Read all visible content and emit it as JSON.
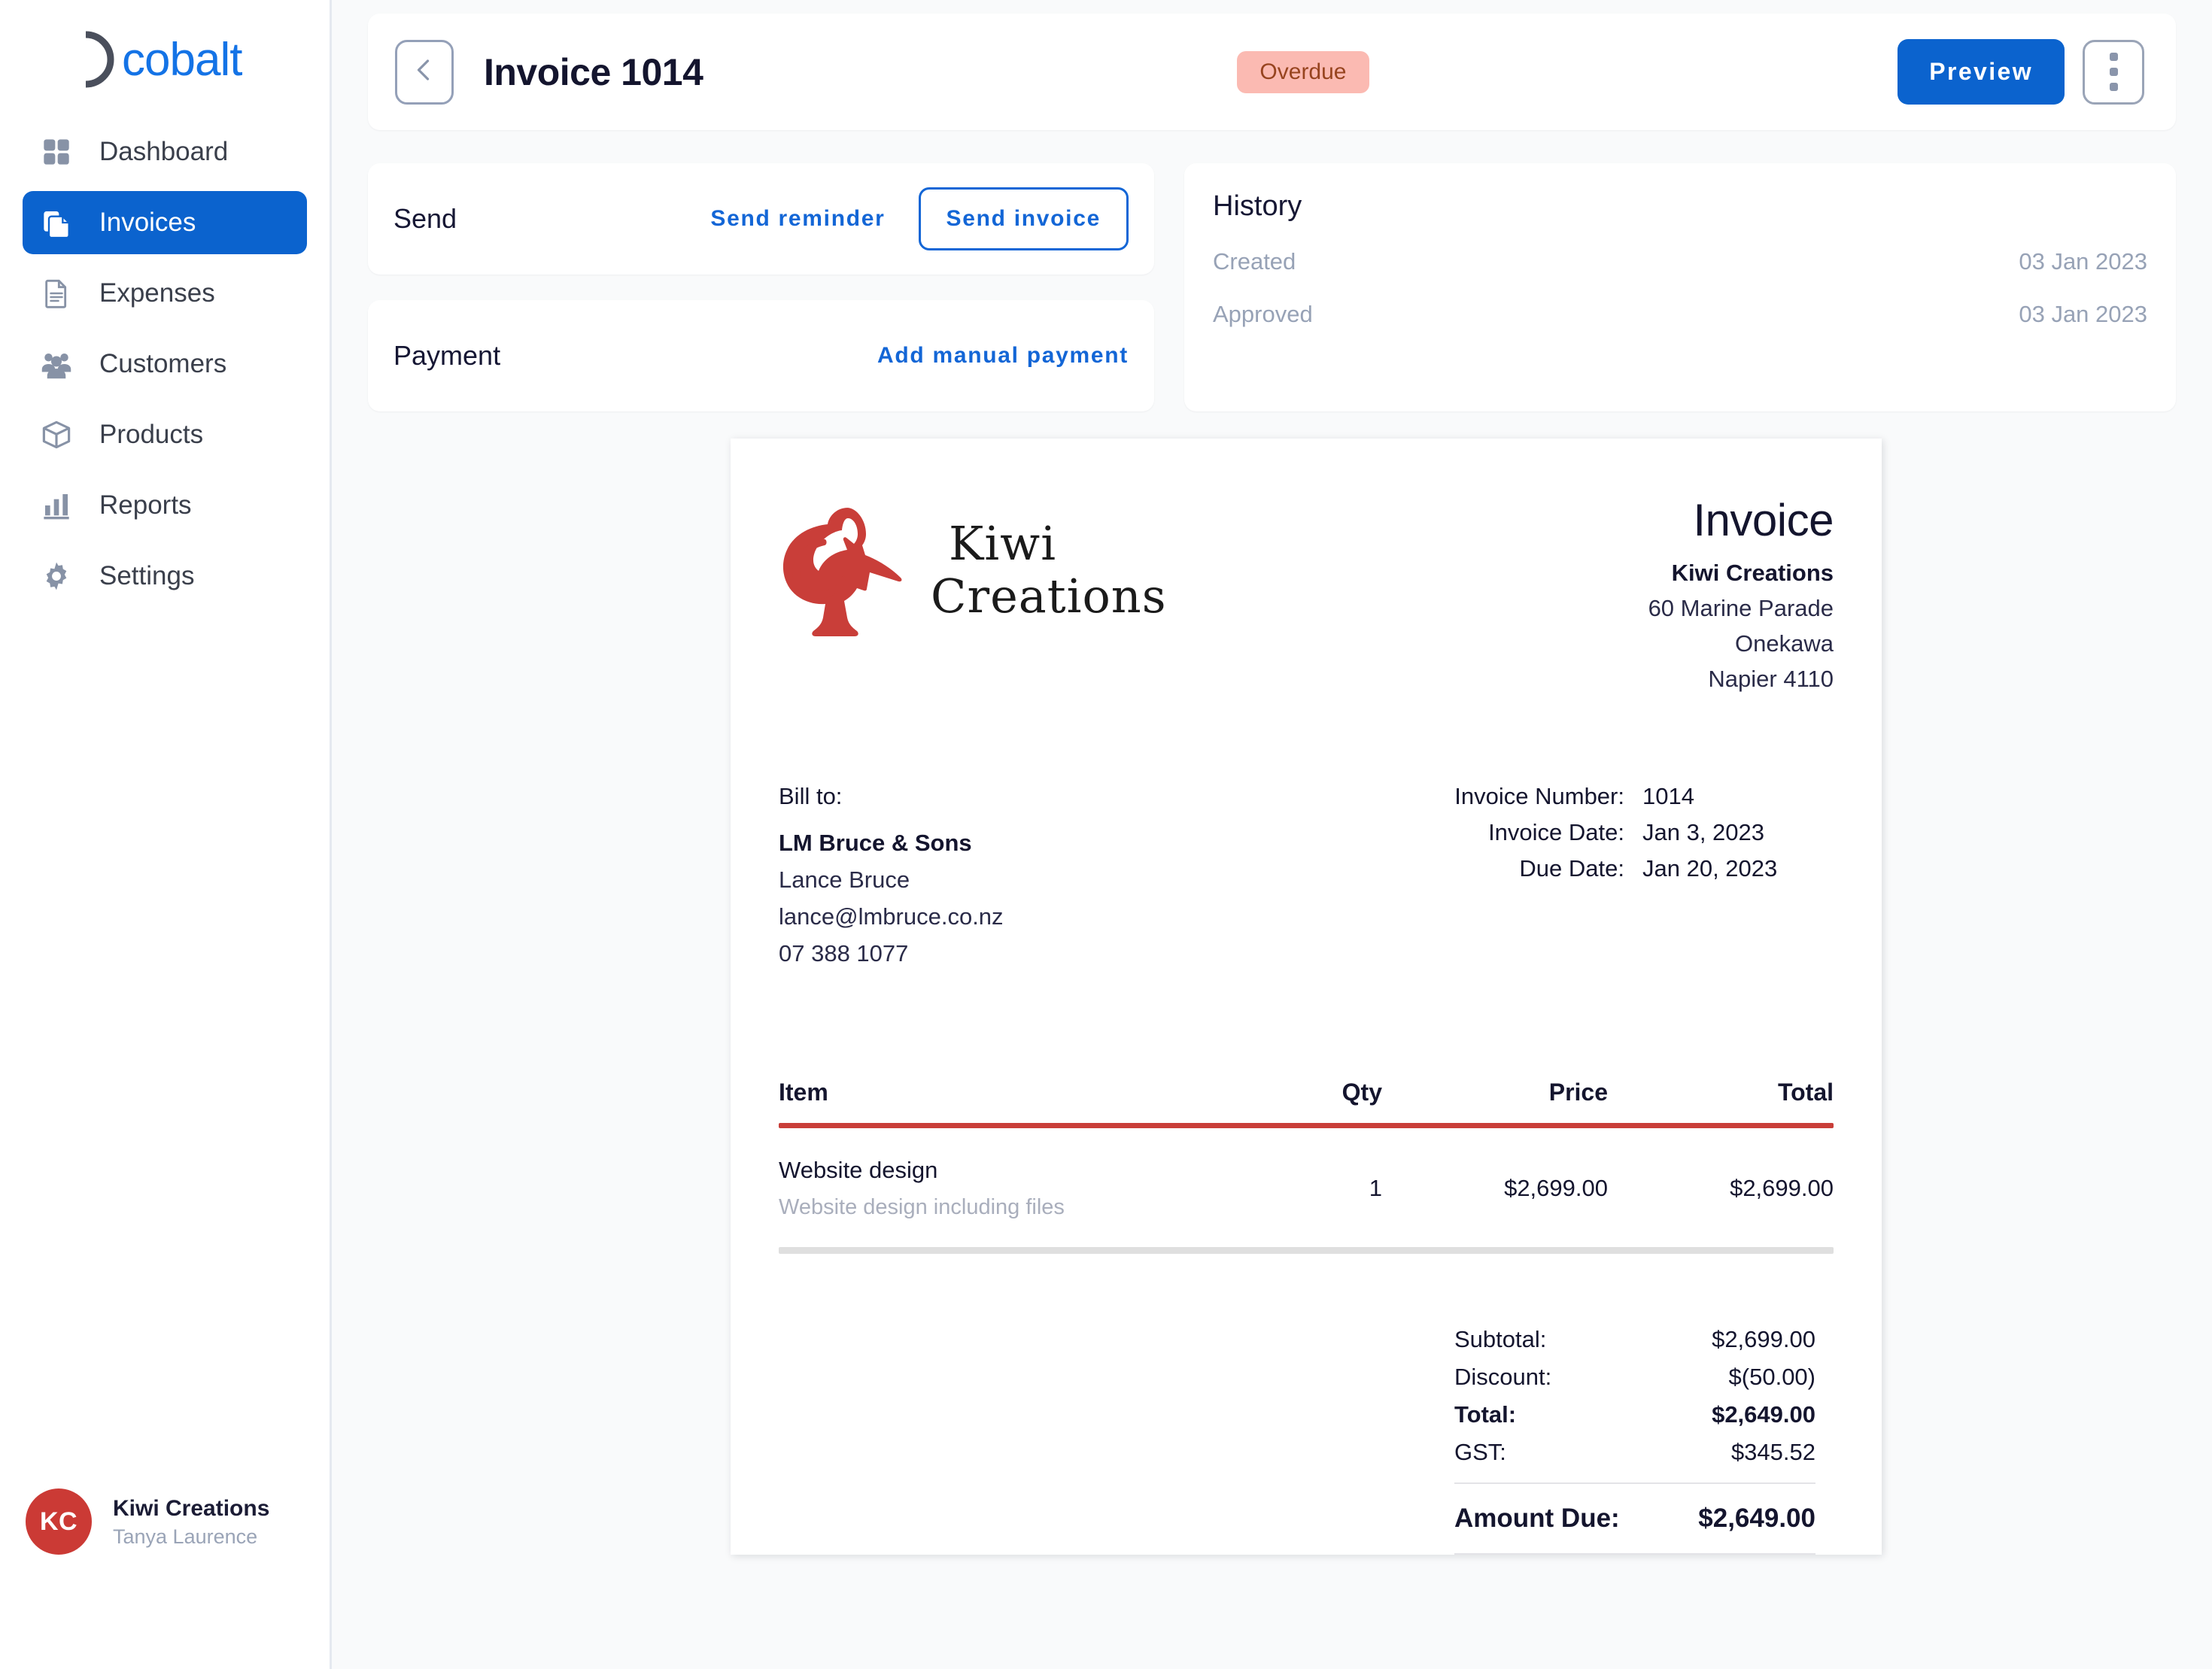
{
  "brand": {
    "word": "cobalt"
  },
  "sidebar": {
    "items": [
      {
        "label": "Dashboard",
        "icon": "grid-icon",
        "active": false
      },
      {
        "label": "Invoices",
        "icon": "documents-icon",
        "active": true
      },
      {
        "label": "Expenses",
        "icon": "document-lines-icon",
        "active": false
      },
      {
        "label": "Customers",
        "icon": "people-icon",
        "active": false
      },
      {
        "label": "Products",
        "icon": "box-icon",
        "active": false
      },
      {
        "label": "Reports",
        "icon": "bar-chart-icon",
        "active": false
      },
      {
        "label": "Settings",
        "icon": "gear-icon",
        "active": false
      }
    ],
    "user": {
      "initials": "KC",
      "org": "Kiwi Creations",
      "name": "Tanya Laurence",
      "avatar_color": "#CB3A35"
    }
  },
  "header": {
    "back_icon": "chevron-left-icon",
    "title": "Invoice 1014",
    "status_badge": "Overdue",
    "status_bg": "#FBBAB2",
    "status_fg": "#97441F",
    "preview_label": "Preview",
    "preview_bg": "#0B63CE",
    "kebab_icon": "more-vertical-icon"
  },
  "actions": {
    "send": {
      "label": "Send",
      "reminder_label": "Send reminder",
      "send_invoice_label": "Send invoice"
    },
    "payment": {
      "label": "Payment",
      "add_manual_label": "Add manual payment"
    },
    "accent": "#1366D6"
  },
  "history": {
    "title": "History",
    "rows": [
      {
        "label": "Created",
        "date": "03 Jan 2023"
      },
      {
        "label": "Approved",
        "date": "03 Jan 2023"
      }
    ]
  },
  "invoice": {
    "logo_icon": "kiwi-bird-icon",
    "logo_color": "#C93E39",
    "logo_word_line1": "Kiwi",
    "logo_word_line2": "Creations",
    "doc_title": "Invoice",
    "business_name": "Kiwi Creations",
    "business_address": [
      "60 Marine Parade",
      "Onekawa",
      "Napier 4110"
    ],
    "bill_to_label": "Bill to:",
    "bill_to_company": "LM Bruce & Sons",
    "bill_to_contact": "Lance Bruce",
    "bill_to_email": "lance@lmbruce.co.nz",
    "bill_to_phone": "07 388 1077",
    "meta": [
      {
        "label": "Invoice Number:",
        "value": "1014"
      },
      {
        "label": "Invoice Date:",
        "value": "Jan 3, 2023"
      },
      {
        "label": "Due Date:",
        "value": "Jan 20, 2023"
      }
    ],
    "table": {
      "columns": [
        "Item",
        "Qty",
        "Price",
        "Total"
      ],
      "rows": [
        {
          "name": "Website design",
          "description": "Website design including files",
          "qty": "1",
          "price": "$2,699.00",
          "total": "$2,699.00"
        }
      ],
      "rule_color": "#C93E39"
    },
    "totals": [
      {
        "label": "Subtotal:",
        "value": "$2,699.00",
        "bold": false
      },
      {
        "label": "Discount:",
        "value": "$(50.00)",
        "bold": false
      },
      {
        "label": "Total:",
        "value": "$2,649.00",
        "bold": true
      },
      {
        "label": "GST:",
        "value": "$345.52",
        "bold": false
      }
    ],
    "amount_due": {
      "label": "Amount Due:",
      "value": "$2,649.00"
    }
  }
}
